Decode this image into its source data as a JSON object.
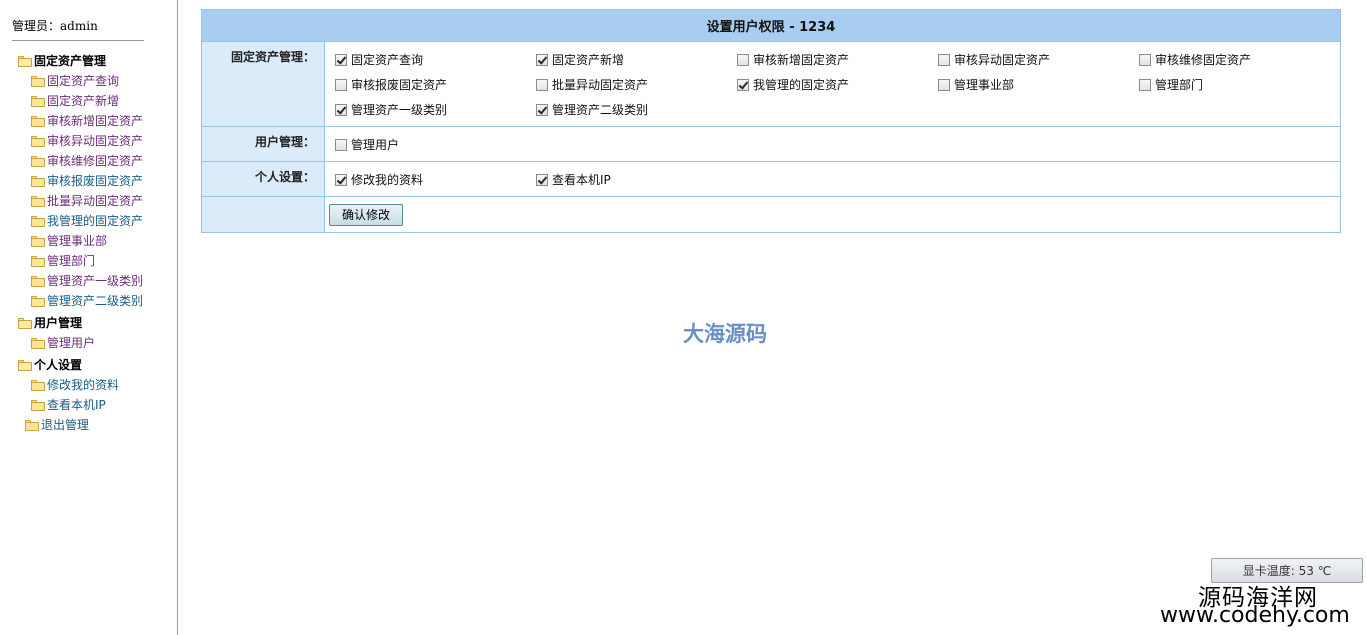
{
  "sidebar": {
    "admin_label": "管理员：",
    "admin_name": "admin",
    "groups": [
      {
        "label": "固定资产管理",
        "items": [
          {
            "label": "固定资产查询",
            "visited": true
          },
          {
            "label": "固定资产新增",
            "visited": true
          },
          {
            "label": "审核新增固定资产",
            "visited": true
          },
          {
            "label": "审核异动固定资产",
            "visited": true
          },
          {
            "label": "审核维修固定资产",
            "visited": true
          },
          {
            "label": "审核报废固定资产",
            "visited": false
          },
          {
            "label": "批量异动固定资产",
            "visited": true
          },
          {
            "label": "我管理的固定资产",
            "visited": false
          },
          {
            "label": "管理事业部",
            "visited": true
          },
          {
            "label": "管理部门",
            "visited": true
          },
          {
            "label": "管理资产一级类别",
            "visited": true
          },
          {
            "label": "管理资产二级类别",
            "visited": false
          }
        ]
      },
      {
        "label": "用户管理",
        "items": [
          {
            "label": "管理用户",
            "visited": true
          }
        ]
      },
      {
        "label": "个人设置",
        "items": [
          {
            "label": "修改我的资料",
            "visited": false
          },
          {
            "label": "查看本机IP",
            "visited": false
          }
        ]
      }
    ],
    "logout_label": "退出管理"
  },
  "form": {
    "title": "设置用户权限  - 1234",
    "sections": [
      {
        "label": "固定资产管理：",
        "options": [
          {
            "label": "固定资产查询",
            "checked": true
          },
          {
            "label": "固定资产新增",
            "checked": true
          },
          {
            "label": "审核新增固定资产",
            "checked": false
          },
          {
            "label": "审核异动固定资产",
            "checked": false
          },
          {
            "label": "审核维修固定资产",
            "checked": false
          },
          {
            "label": "审核报废固定资产",
            "checked": false
          },
          {
            "label": "批量异动固定资产",
            "checked": false
          },
          {
            "label": "我管理的固定资产",
            "checked": true
          },
          {
            "label": "管理事业部",
            "checked": false
          },
          {
            "label": "管理部门",
            "checked": false
          },
          {
            "label": "管理资产一级类别",
            "checked": true
          },
          {
            "label": "管理资产二级类别",
            "checked": true
          }
        ]
      },
      {
        "label": "用户管理：",
        "options": [
          {
            "label": "管理用户",
            "checked": false
          }
        ]
      },
      {
        "label": "个人设置：",
        "options": [
          {
            "label": "修改我的资料",
            "checked": true
          },
          {
            "label": "查看本机IP",
            "checked": true
          }
        ]
      }
    ],
    "submit_label": "确认修改"
  },
  "watermark": "大海源码",
  "gpu_temp": "显卡温度: 53 ℃",
  "site": {
    "cn_name": "源码海洋网",
    "url": "www.codehy.com"
  },
  "colors": {
    "title_bg": "#a9cdf0",
    "label_bg": "#dcebfa",
    "border": "#9cc3e0",
    "link": "#1b5c87",
    "visited_link": "#6b2f7a",
    "watermark": "#6a8fc6"
  },
  "icons": {
    "tree_node": "folder-icon",
    "group_node": "folder-open-icon",
    "checkbox": "checkbox-icon"
  }
}
